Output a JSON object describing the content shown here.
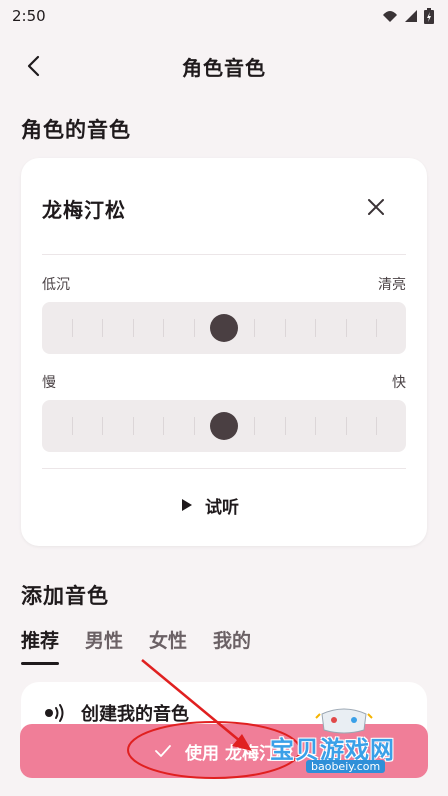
{
  "status_bar": {
    "time": "2:50"
  },
  "app_bar": {
    "title": "角色音色"
  },
  "current_section": {
    "title": "角色的音色"
  },
  "voice_card": {
    "voice_name": "龙梅汀松",
    "pitch_slider": {
      "min_label": "低沉",
      "max_label": "清亮",
      "value": 0.5
    },
    "speed_slider": {
      "min_label": "慢",
      "max_label": "快",
      "value": 0.5
    },
    "preview_label": "试听"
  },
  "add_section": {
    "title": "添加音色",
    "tabs": [
      {
        "label": "推荐",
        "active": true
      },
      {
        "label": "男性",
        "active": false
      },
      {
        "label": "女性",
        "active": false
      },
      {
        "label": "我的",
        "active": false
      }
    ],
    "list_item": {
      "label": "创建我的音色"
    }
  },
  "apply_button": {
    "label": "使用 龙梅汀松"
  },
  "watermark": {
    "text": "宝贝游戏网",
    "url": "baobeiy.com"
  },
  "colors": {
    "accent": "#f07e98",
    "annotation": "#e02020",
    "background": "#f7f3f4"
  }
}
